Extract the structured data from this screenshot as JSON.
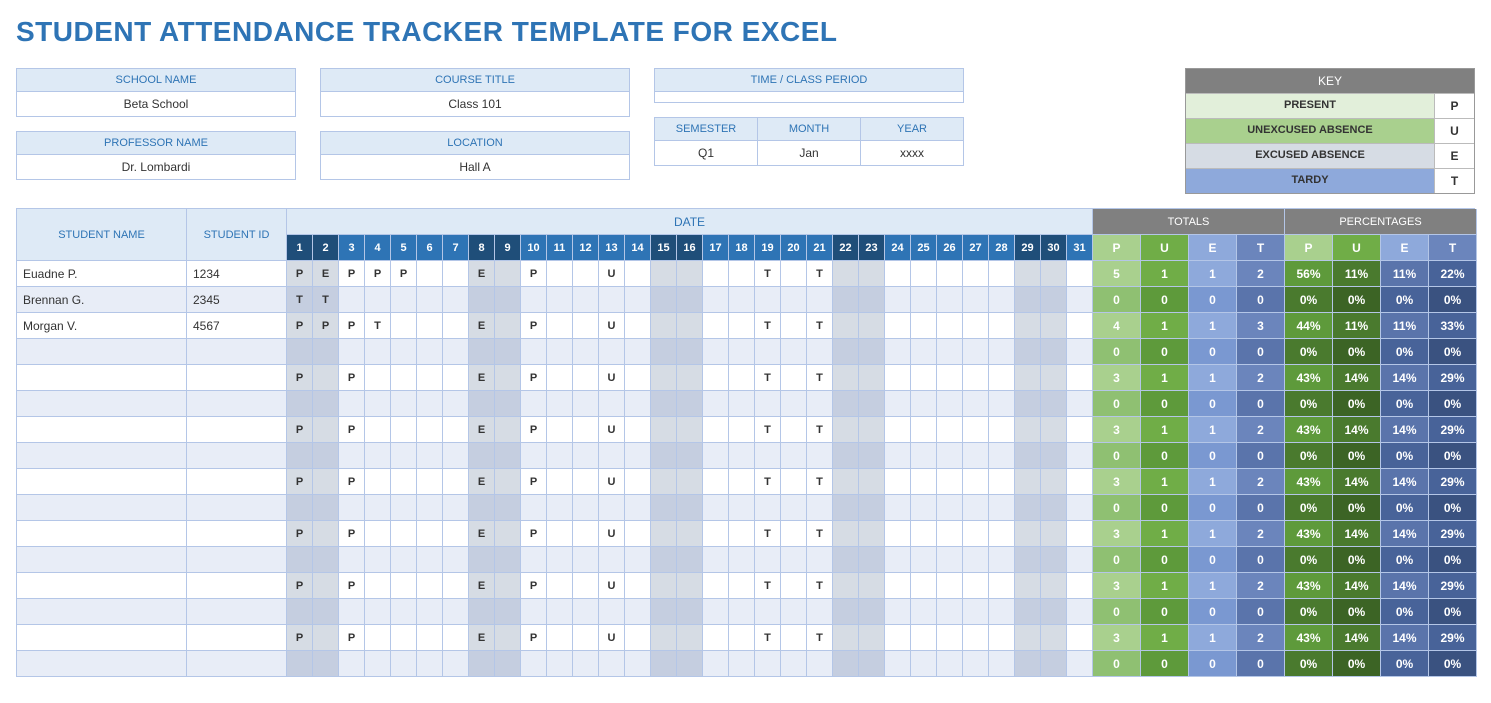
{
  "title": "STUDENT ATTENDANCE TRACKER TEMPLATE FOR EXCEL",
  "info": {
    "school_label": "SCHOOL NAME",
    "school_value": "Beta School",
    "course_label": "COURSE TITLE",
    "course_value": "Class 101",
    "time_label": "TIME / CLASS PERIOD",
    "time_value": "",
    "prof_label": "PROFESSOR NAME",
    "prof_value": "Dr. Lombardi",
    "loc_label": "LOCATION",
    "loc_value": "Hall A",
    "sem_label": "SEMESTER",
    "sem_value": "Q1",
    "month_label": "MONTH",
    "month_value": "Jan",
    "year_label": "YEAR",
    "year_value": "xxxx"
  },
  "key": {
    "title": "KEY",
    "rows": [
      {
        "label": "PRESENT",
        "code": "P",
        "cls": "k-present"
      },
      {
        "label": "UNEXCUSED ABSENCE",
        "code": "U",
        "cls": "k-unex"
      },
      {
        "label": "EXCUSED ABSENCE",
        "code": "E",
        "cls": "k-ex"
      },
      {
        "label": "TARDY",
        "code": "T",
        "cls": "k-tardy"
      }
    ]
  },
  "headers": {
    "student_name": "STUDENT NAME",
    "student_id": "STUDENT ID",
    "date": "DATE",
    "totals": "TOTALS",
    "percentages": "PERCENTAGES",
    "day_colors": [
      "#1f4e79",
      "#1f4e79",
      "#2e74b5",
      "#2e74b5",
      "#2e74b5",
      "#2e74b5",
      "#2e74b5",
      "#1f4e79",
      "#1f4e79",
      "#2e74b5",
      "#2e74b5",
      "#2e74b5",
      "#2e74b5",
      "#2e74b5",
      "#1f4e79",
      "#1f4e79",
      "#2e74b5",
      "#2e74b5",
      "#2e74b5",
      "#2e74b5",
      "#2e74b5",
      "#1f4e79",
      "#1f4e79",
      "#2e74b5",
      "#2e74b5",
      "#2e74b5",
      "#2e74b5",
      "#2e74b5",
      "#1f4e79",
      "#1f4e79",
      "#2e74b5"
    ],
    "stat_cols": [
      "P",
      "U",
      "E",
      "T",
      "P",
      "U",
      "E",
      "T"
    ]
  },
  "rows": [
    {
      "name": "Euadne P.",
      "id": "1234",
      "days": [
        "P",
        "E",
        "P",
        "P",
        "P",
        "",
        "",
        "E",
        "",
        "P",
        "",
        "",
        "U",
        "",
        "",
        "",
        "",
        "",
        "T",
        "",
        "T",
        "",
        "",
        "",
        "",
        "",
        "",
        "",
        "",
        "",
        ""
      ],
      "stats": [
        "5",
        "1",
        "1",
        "2",
        "56%",
        "11%",
        "11%",
        "22%"
      ]
    },
    {
      "name": "Brennan G.",
      "id": "2345",
      "days": [
        "T",
        "T",
        "",
        "",
        "",
        "",
        "",
        "",
        "",
        "",
        "",
        "",
        "",
        "",
        "",
        "",
        "",
        "",
        "",
        "",
        "",
        "",
        "",
        "",
        "",
        "",
        "",
        "",
        "",
        "",
        ""
      ],
      "stats": [
        "0",
        "0",
        "0",
        "0",
        "0%",
        "0%",
        "0%",
        "0%"
      ]
    },
    {
      "name": "Morgan V.",
      "id": "4567",
      "days": [
        "P",
        "P",
        "P",
        "T",
        "",
        "",
        "",
        "E",
        "",
        "P",
        "",
        "",
        "U",
        "",
        "",
        "",
        "",
        "",
        "T",
        "",
        "T",
        "",
        "",
        "",
        "",
        "",
        "",
        "",
        "",
        "",
        ""
      ],
      "stats": [
        "4",
        "1",
        "1",
        "3",
        "44%",
        "11%",
        "11%",
        "33%"
      ]
    },
    {
      "name": "",
      "id": "",
      "days": [
        "",
        "",
        "",
        "",
        "",
        "",
        "",
        "",
        "",
        "",
        "",
        "",
        "",
        "",
        "",
        "",
        "",
        "",
        "",
        "",
        "",
        "",
        "",
        "",
        "",
        "",
        "",
        "",
        "",
        "",
        ""
      ],
      "stats": [
        "0",
        "0",
        "0",
        "0",
        "0%",
        "0%",
        "0%",
        "0%"
      ]
    },
    {
      "name": "",
      "id": "",
      "days": [
        "P",
        "",
        "P",
        "",
        "",
        "",
        "",
        "E",
        "",
        "P",
        "",
        "",
        "U",
        "",
        "",
        "",
        "",
        "",
        "T",
        "",
        "T",
        "",
        "",
        "",
        "",
        "",
        "",
        "",
        "",
        "",
        ""
      ],
      "stats": [
        "3",
        "1",
        "1",
        "2",
        "43%",
        "14%",
        "14%",
        "29%"
      ]
    },
    {
      "name": "",
      "id": "",
      "days": [
        "",
        "",
        "",
        "",
        "",
        "",
        "",
        "",
        "",
        "",
        "",
        "",
        "",
        "",
        "",
        "",
        "",
        "",
        "",
        "",
        "",
        "",
        "",
        "",
        "",
        "",
        "",
        "",
        "",
        "",
        ""
      ],
      "stats": [
        "0",
        "0",
        "0",
        "0",
        "0%",
        "0%",
        "0%",
        "0%"
      ]
    },
    {
      "name": "",
      "id": "",
      "days": [
        "P",
        "",
        "P",
        "",
        "",
        "",
        "",
        "E",
        "",
        "P",
        "",
        "",
        "U",
        "",
        "",
        "",
        "",
        "",
        "T",
        "",
        "T",
        "",
        "",
        "",
        "",
        "",
        "",
        "",
        "",
        "",
        ""
      ],
      "stats": [
        "3",
        "1",
        "1",
        "2",
        "43%",
        "14%",
        "14%",
        "29%"
      ]
    },
    {
      "name": "",
      "id": "",
      "days": [
        "",
        "",
        "",
        "",
        "",
        "",
        "",
        "",
        "",
        "",
        "",
        "",
        "",
        "",
        "",
        "",
        "",
        "",
        "",
        "",
        "",
        "",
        "",
        "",
        "",
        "",
        "",
        "",
        "",
        "",
        ""
      ],
      "stats": [
        "0",
        "0",
        "0",
        "0",
        "0%",
        "0%",
        "0%",
        "0%"
      ]
    },
    {
      "name": "",
      "id": "",
      "days": [
        "P",
        "",
        "P",
        "",
        "",
        "",
        "",
        "E",
        "",
        "P",
        "",
        "",
        "U",
        "",
        "",
        "",
        "",
        "",
        "T",
        "",
        "T",
        "",
        "",
        "",
        "",
        "",
        "",
        "",
        "",
        "",
        ""
      ],
      "stats": [
        "3",
        "1",
        "1",
        "2",
        "43%",
        "14%",
        "14%",
        "29%"
      ]
    },
    {
      "name": "",
      "id": "",
      "days": [
        "",
        "",
        "",
        "",
        "",
        "",
        "",
        "",
        "",
        "",
        "",
        "",
        "",
        "",
        "",
        "",
        "",
        "",
        "",
        "",
        "",
        "",
        "",
        "",
        "",
        "",
        "",
        "",
        "",
        "",
        ""
      ],
      "stats": [
        "0",
        "0",
        "0",
        "0",
        "0%",
        "0%",
        "0%",
        "0%"
      ]
    },
    {
      "name": "",
      "id": "",
      "days": [
        "P",
        "",
        "P",
        "",
        "",
        "",
        "",
        "E",
        "",
        "P",
        "",
        "",
        "U",
        "",
        "",
        "",
        "",
        "",
        "T",
        "",
        "T",
        "",
        "",
        "",
        "",
        "",
        "",
        "",
        "",
        "",
        ""
      ],
      "stats": [
        "3",
        "1",
        "1",
        "2",
        "43%",
        "14%",
        "14%",
        "29%"
      ]
    },
    {
      "name": "",
      "id": "",
      "days": [
        "",
        "",
        "",
        "",
        "",
        "",
        "",
        "",
        "",
        "",
        "",
        "",
        "",
        "",
        "",
        "",
        "",
        "",
        "",
        "",
        "",
        "",
        "",
        "",
        "",
        "",
        "",
        "",
        "",
        "",
        ""
      ],
      "stats": [
        "0",
        "0",
        "0",
        "0",
        "0%",
        "0%",
        "0%",
        "0%"
      ]
    },
    {
      "name": "",
      "id": "",
      "days": [
        "P",
        "",
        "P",
        "",
        "",
        "",
        "",
        "E",
        "",
        "P",
        "",
        "",
        "U",
        "",
        "",
        "",
        "",
        "",
        "T",
        "",
        "T",
        "",
        "",
        "",
        "",
        "",
        "",
        "",
        "",
        "",
        ""
      ],
      "stats": [
        "3",
        "1",
        "1",
        "2",
        "43%",
        "14%",
        "14%",
        "29%"
      ]
    },
    {
      "name": "",
      "id": "",
      "days": [
        "",
        "",
        "",
        "",
        "",
        "",
        "",
        "",
        "",
        "",
        "",
        "",
        "",
        "",
        "",
        "",
        "",
        "",
        "",
        "",
        "",
        "",
        "",
        "",
        "",
        "",
        "",
        "",
        "",
        "",
        ""
      ],
      "stats": [
        "0",
        "0",
        "0",
        "0",
        "0%",
        "0%",
        "0%",
        "0%"
      ]
    },
    {
      "name": "",
      "id": "",
      "days": [
        "P",
        "",
        "P",
        "",
        "",
        "",
        "",
        "E",
        "",
        "P",
        "",
        "",
        "U",
        "",
        "",
        "",
        "",
        "",
        "T",
        "",
        "T",
        "",
        "",
        "",
        "",
        "",
        "",
        "",
        "",
        "",
        ""
      ],
      "stats": [
        "3",
        "1",
        "1",
        "2",
        "43%",
        "14%",
        "14%",
        "29%"
      ]
    },
    {
      "name": "",
      "id": "",
      "days": [
        "",
        "",
        "",
        "",
        "",
        "",
        "",
        "",
        "",
        "",
        "",
        "",
        "",
        "",
        "",
        "",
        "",
        "",
        "",
        "",
        "",
        "",
        "",
        "",
        "",
        "",
        "",
        "",
        "",
        "",
        ""
      ],
      "stats": [
        "0",
        "0",
        "0",
        "0",
        "0%",
        "0%",
        "0%",
        "0%"
      ]
    }
  ]
}
